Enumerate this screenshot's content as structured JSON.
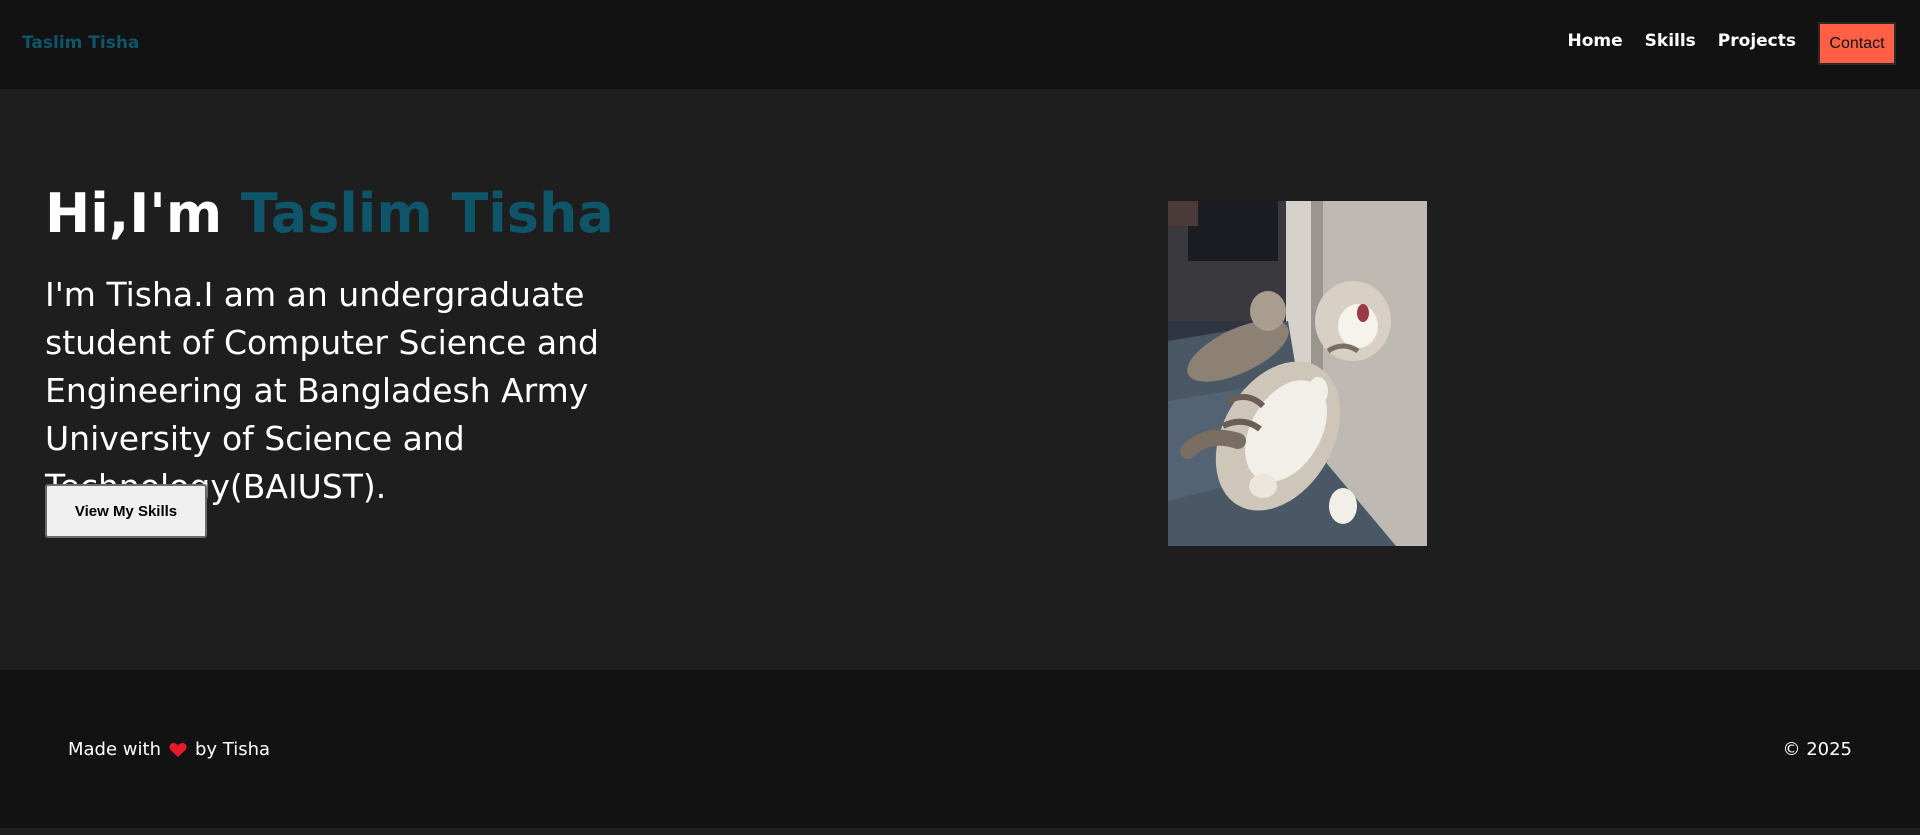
{
  "nav": {
    "brand": "Taslim Tisha",
    "links": [
      "Home",
      "Skills",
      "Projects"
    ],
    "contact": "Contact"
  },
  "hero": {
    "greeting": "Hi,I'm ",
    "name": "Taslim Tisha",
    "description": "I'm Tisha.I am an undergraduate student of Computer Science and Engineering at Bangladesh Army University of Science and Technology(BAIUST).",
    "button": "View My Skills",
    "image_icon": "cat-photo"
  },
  "footer": {
    "made_with": "Made with",
    "heart_icon": "heart-icon",
    "by": "by Tisha",
    "copyright": "© 2025"
  },
  "colors": {
    "accent": "#0e5569",
    "contact_button": "#ff5f45",
    "heart": "#e8192c",
    "nav_background": "#121212",
    "page_background": "#1e1e1e"
  }
}
